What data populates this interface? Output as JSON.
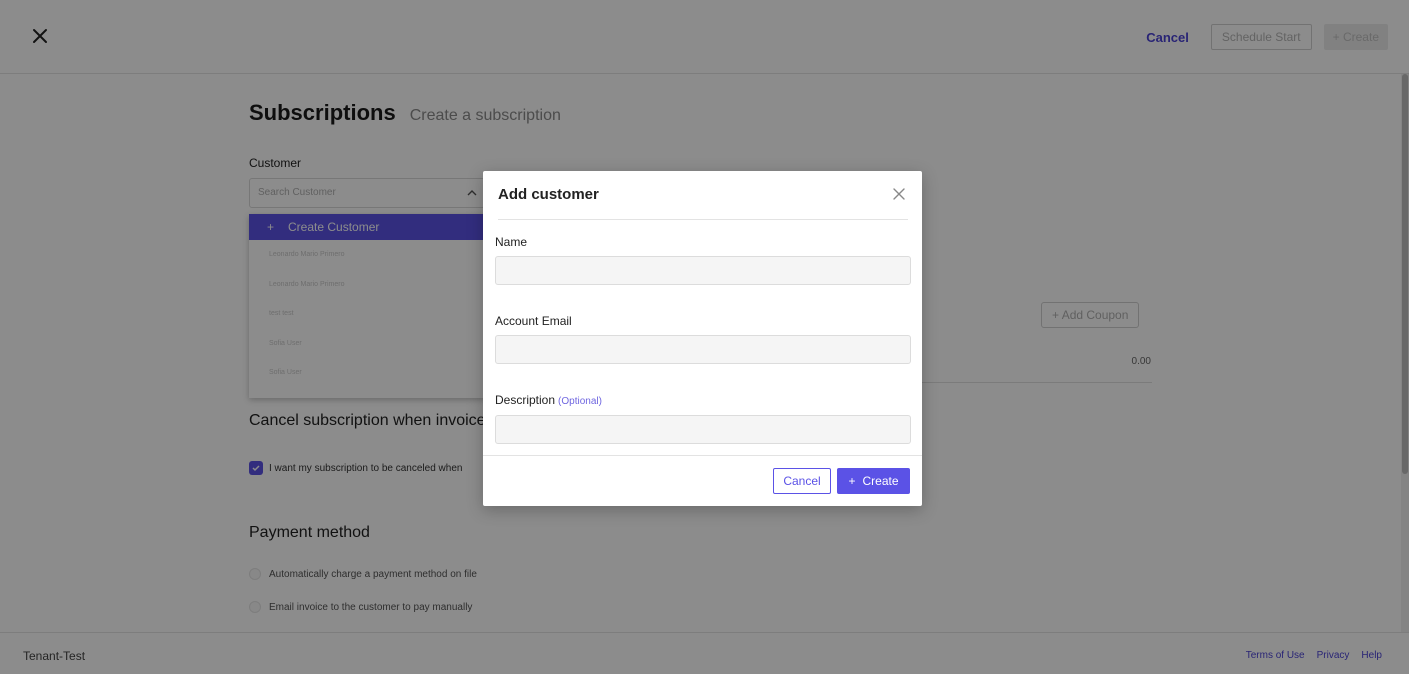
{
  "header": {
    "cancel_label": "Cancel",
    "schedule_label": "Schedule Start",
    "create_label": "Create",
    "create_icon": "+"
  },
  "main": {
    "title": "Subscriptions",
    "subtitle": "Create a subscription",
    "customer_label": "Customer",
    "customer_search_placeholder": "Search Customer",
    "create_customer_icon": "+",
    "create_customer_label": "Create Customer",
    "customer_options": [
      "Leonardo Mario Primero",
      "Leonardo Mario Primero",
      "test test",
      "Sofia User",
      "Sofia User"
    ],
    "add_coupon_icon": "+",
    "add_coupon_label": "Add Coupon",
    "total_value": "0.00",
    "cancel_section_title": "Cancel subscription when invoice",
    "cancel_checkbox_label": "I want my subscription to be canceled when",
    "payment_section_title": "Payment method",
    "payment_options": [
      "Automatically charge a payment method on file",
      "Email invoice to the customer to pay manually"
    ]
  },
  "footer": {
    "tenant": "Tenant-Test",
    "links": [
      "Terms of Use",
      "Privacy",
      "Help"
    ]
  },
  "modal": {
    "title": "Add customer",
    "name_label": "Name",
    "name_value": "",
    "email_label": "Account Email",
    "email_value": "",
    "description_label": "Description",
    "description_optional": "(Optional)",
    "description_value": "",
    "cancel_label": "Cancel",
    "create_icon": "+",
    "create_label": "Create"
  },
  "colors": {
    "accent": "#5b52e6",
    "link": "#4b43d6",
    "overlay": "rgba(0,0,0,0.45)"
  }
}
